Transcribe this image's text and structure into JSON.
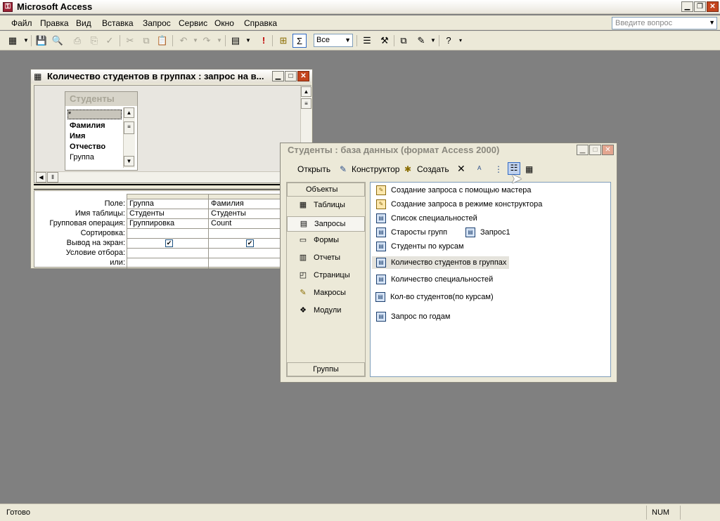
{
  "app": {
    "title": "Microsoft Access",
    "icon": "access-key-icon",
    "help_placeholder": "Введите вопрос"
  },
  "menu": [
    "Файл",
    "Правка",
    "Вид",
    "Вставка",
    "Запрос",
    "Сервис",
    "Окно",
    "Справка"
  ],
  "toolbar": {
    "top_values": "Все",
    "icons": [
      "view-icon",
      "save-icon",
      "print-preview-icon",
      "print-icon",
      "spell-check-icon",
      "cut-icon",
      "copy-icon",
      "paste-icon",
      "undo-icon",
      "redo-icon",
      "query-type-icon",
      "run-icon",
      "show-table-icon",
      "totals-icon",
      "properties-icon",
      "build-icon",
      "database-window-icon",
      "new-object-icon",
      "help-icon"
    ]
  },
  "query_window": {
    "title": "Количество студентов в группах : запрос на в...",
    "table": {
      "name": "Студенты",
      "fields": [
        "*",
        "Фамилия",
        "Имя",
        "Отчество",
        "Группа"
      ]
    },
    "row_labels": [
      "Поле:",
      "Имя таблицы:",
      "Групповая операция:",
      "Сортировка:",
      "Вывод на экран:",
      "Условие отбора:",
      "или:"
    ],
    "columns": [
      {
        "field": "Группа",
        "table": "Студенты",
        "total": "Группировка",
        "sort": "",
        "show": true
      },
      {
        "field": "Фамилия",
        "table": "Студенты",
        "total": "Count",
        "sort": "",
        "show": true
      }
    ]
  },
  "db_window": {
    "title": "Студенты : база данных (формат Access 2000)",
    "toolbar": {
      "open": "Открыть",
      "design": "Конструктор",
      "create": "Создать"
    },
    "objects_header": "Объекты",
    "objects": [
      {
        "label": "Таблицы",
        "icon": "table-icon"
      },
      {
        "label": "Запросы",
        "icon": "query-icon"
      },
      {
        "label": "Формы",
        "icon": "form-icon"
      },
      {
        "label": "Отчеты",
        "icon": "report-icon"
      },
      {
        "label": "Страницы",
        "icon": "page-icon"
      },
      {
        "label": "Макросы",
        "icon": "macro-icon"
      },
      {
        "label": "Модули",
        "icon": "module-icon"
      }
    ],
    "groups": "Группы",
    "items": [
      "Создание запроса с помощью мастера",
      "Создание запроса в режиме конструктора",
      "Список специальностей",
      "Старосты групп",
      "Запрос1",
      "Студенты по курсам",
      "Количество студентов в группах",
      "Количество специальностей",
      "Кол-во студентов(по курсам)",
      "Запрос по годам"
    ]
  },
  "status": {
    "text": "Готово",
    "num": "NUM"
  }
}
